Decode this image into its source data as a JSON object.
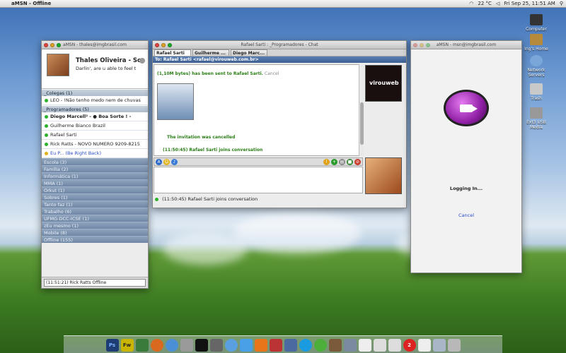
{
  "menubar": {
    "app_name": "aMSN - Offline",
    "temperature": "22 °C",
    "clock": "Fri Sep 25, 11:51 AM"
  },
  "desktop": {
    "icons": [
      "Computer",
      "Ing's Home",
      "Network Servers",
      "Trash",
      "Ext3 USB Media"
    ]
  },
  "contact_list": {
    "title": "aMSN - thales@imgbrasil.com",
    "user_name": "Thales Oliveira - Sc",
    "personal_message": "Darlin', are u able to feel t",
    "groups_top": [
      {
        "label": "_Colegas (1)"
      },
      {
        "label": "_Programadores (5)"
      }
    ],
    "colegas": [
      {
        "text": "LEO - !Não tenho medo nem de chuvas"
      }
    ],
    "programadores": [
      {
        "text": "Diego Marcell² - ● Boa Sorte ! -"
      },
      {
        "text": "Guilherme Bianco Brazil"
      },
      {
        "text": "Rafael Sarti"
      },
      {
        "text": "Rick Ratts - NOVO NUMERO 9209-8215"
      },
      {
        "text": "Eu P... (Be Right Back)"
      }
    ],
    "collapsed_groups": [
      "Escola (3)",
      "Família (2)",
      "Informática (1)",
      "MMA (1)",
      "Orkut (1)",
      "Sobres (1)",
      "Tanto faz (1)",
      "Trabalho (6)",
      "UFMG-DCC-ICSE (1)",
      "zEu mesmo (1)",
      "Mobile (8)",
      "Offline (155)"
    ],
    "status_select": "(11:51:21) Rick Ratts Offline"
  },
  "chat": {
    "title": "Rafael Sarti : _Programadores - Chat",
    "tabs": [
      "Rafael Sarti",
      "Guilherme ...",
      "Diego Marc..."
    ],
    "to_line": "To: Rafael Sarti <rafael@virouweb.com.br>",
    "messages": {
      "transfer": "(1,10M bytes) has been sent to Rafael Sarti.",
      "transfer_cancel": "Cancel",
      "invitation_cancelled": "The invitation was cancelled",
      "joins": "(11:50:45) Rafael Sarti joins conversation"
    },
    "display_pic_text": "virouweb",
    "status_line": "(11:50:45) Rafael Sarti joins conversation",
    "colors": {
      "accent_green": "#2a7d16",
      "to_bar": "#3d5f91"
    }
  },
  "video": {
    "title": "aMSN - msn@imgbrasil.com",
    "logging": "Logging In...",
    "cancel": "Cancel",
    "icon": "video-chat-icon"
  },
  "dock": {
    "items": [
      "Ps",
      "Fw",
      "",
      "",
      "",
      "",
      "",
      "",
      "",
      "",
      "",
      "",
      "",
      "",
      "",
      "",
      "",
      "",
      "",
      "",
      "2",
      "",
      "",
      ""
    ]
  }
}
